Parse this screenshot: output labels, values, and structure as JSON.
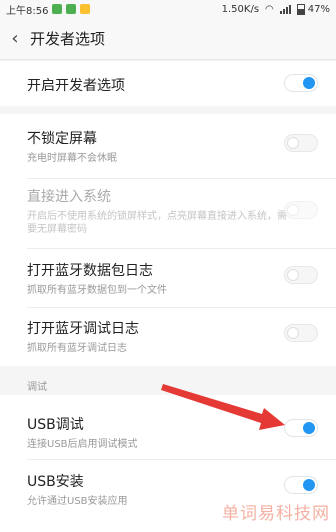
{
  "status_bar": {
    "time": "上午8:56",
    "network_speed": "1.50K/s",
    "battery": "47%",
    "battery_level": 0.47
  },
  "header": {
    "back_icon": "back-arrow-icon",
    "title": "开发者选项"
  },
  "settings": {
    "developer_options": {
      "title": "开启开发者选项",
      "enabled": true
    },
    "stay_awake": {
      "title": "不锁定屏幕",
      "subtitle": "充电时屏幕不会休眠",
      "enabled": false
    },
    "direct_boot": {
      "title": "直接进入系统",
      "subtitle": "开启后不使用系统的锁屏样式，点亮屏幕直接进入系统，需要无屏幕密码",
      "enabled": false,
      "disabled": true
    },
    "bt_snoop_log": {
      "title": "打开蓝牙数据包日志",
      "subtitle": "抓取所有蓝牙数据包到一个文件",
      "enabled": false
    },
    "bt_debug_log": {
      "title": "打开蓝牙调试日志",
      "subtitle": "抓取所有蓝牙调试日志",
      "enabled": false
    }
  },
  "debug_section": {
    "label": "调试",
    "usb_debugging": {
      "title": "USB调试",
      "subtitle": "连接USB后启用调试模式",
      "enabled": true
    },
    "usb_install": {
      "title": "USB安装",
      "subtitle": "允许通过USB安装应用",
      "enabled": true
    }
  },
  "watermark": "单词易科技网",
  "colors": {
    "accent": "#2196f3",
    "annotation_arrow": "#e53935"
  }
}
